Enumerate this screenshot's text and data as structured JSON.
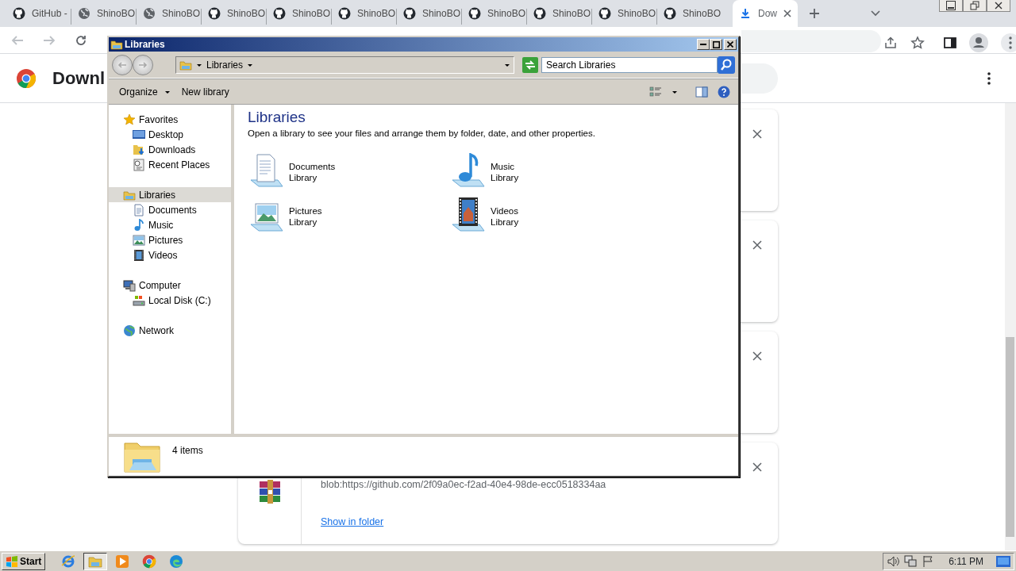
{
  "browser": {
    "tabs": [
      {
        "title": "GitHub -",
        "kind": "github",
        "selected": false
      },
      {
        "title": "ShinoBO",
        "kind": "globe",
        "selected": false
      },
      {
        "title": "ShinoBO",
        "kind": "globe",
        "selected": false
      },
      {
        "title": "ShinoBO",
        "kind": "github",
        "selected": false
      },
      {
        "title": "ShinoBO",
        "kind": "github",
        "selected": false
      },
      {
        "title": "ShinoBO",
        "kind": "github",
        "selected": false
      },
      {
        "title": "ShinoBO",
        "kind": "github",
        "selected": false
      },
      {
        "title": "ShinoBO",
        "kind": "github",
        "selected": false
      },
      {
        "title": "ShinoBO",
        "kind": "github",
        "selected": false
      },
      {
        "title": "ShinoBO",
        "kind": "github",
        "selected": false
      },
      {
        "title": "ShinoBO",
        "kind": "github",
        "selected": false
      },
      {
        "title": "Dow",
        "kind": "download",
        "selected": true
      }
    ],
    "page_title": "Downl",
    "downloads": [
      {
        "kind": "covered"
      },
      {
        "kind": "covered"
      },
      {
        "kind": "covered"
      },
      {
        "kind": "file",
        "url": "blob:https://github.com/2f09a0ec-f2ad-40e4-98de-ecc0518334aa",
        "action": "Show in folder"
      }
    ]
  },
  "explorer": {
    "title": "Libraries",
    "address": "Libraries",
    "search": {
      "placeholder": "Search Libraries"
    },
    "commands": [
      {
        "label": "Organize",
        "dropdown": true
      },
      {
        "label": "New library",
        "dropdown": false
      }
    ],
    "nav": [
      {
        "label": "Favorites",
        "kind": "star",
        "selected": false,
        "children": [
          {
            "label": "Desktop",
            "kind": "desktop",
            "selected": false
          },
          {
            "label": "Downloads",
            "kind": "downloads",
            "selected": false
          },
          {
            "label": "Recent Places",
            "kind": "recent",
            "selected": false
          }
        ]
      },
      {
        "label": "Libraries",
        "kind": "library",
        "selected": true,
        "children": [
          {
            "label": "Documents",
            "kind": "documents",
            "selected": false
          },
          {
            "label": "Music",
            "kind": "music",
            "selected": false
          },
          {
            "label": "Pictures",
            "kind": "pictures",
            "selected": false
          },
          {
            "label": "Videos",
            "kind": "videos",
            "selected": false
          }
        ]
      },
      {
        "label": "Computer",
        "kind": "computer",
        "selected": false,
        "children": [
          {
            "label": "Local Disk (C:)",
            "kind": "disk",
            "selected": false
          }
        ]
      },
      {
        "label": "Network",
        "kind": "network",
        "selected": false
      }
    ],
    "heading": "Libraries",
    "description": "Open a library to see your files and arrange them by folder, date, and other properties.",
    "libraries": [
      {
        "name": "Documents",
        "type": "Library",
        "kind": "documents"
      },
      {
        "name": "Music",
        "type": "Library",
        "kind": "music"
      },
      {
        "name": "Pictures",
        "type": "Library",
        "kind": "pictures"
      },
      {
        "name": "Videos",
        "type": "Library",
        "kind": "videos"
      }
    ],
    "status": "4 items"
  },
  "taskbar": {
    "start": "Start",
    "apps": [
      {
        "kind": "ie",
        "active": false
      },
      {
        "kind": "explorer",
        "active": true
      },
      {
        "kind": "media",
        "active": false
      },
      {
        "kind": "chrome",
        "active": false
      },
      {
        "kind": "edge",
        "active": false
      }
    ],
    "time": "6:11 PM"
  }
}
